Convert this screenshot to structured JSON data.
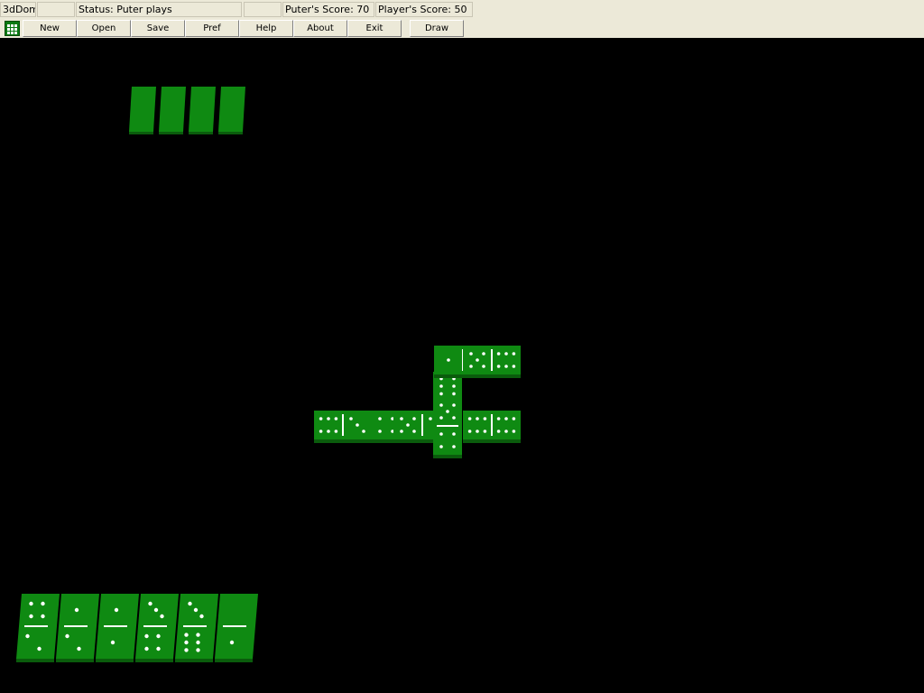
{
  "status": {
    "app_name": "3dDom",
    "blank1": "",
    "status_text": "Status: Puter plays",
    "blank2": "",
    "puter_score": "Puter's Score: 70",
    "player_score": "Player's Score: 50"
  },
  "toolbar": {
    "new_label": "New",
    "open_label": "Open",
    "save_label": "Save",
    "pref_label": "Pref",
    "help_label": "Help",
    "about_label": "About",
    "exit_label": "Exit",
    "draw_label": "Draw"
  },
  "game": {
    "tile_color": "#0f8a12",
    "tile_side_color": "#0a5c0c",
    "pip_color": "#ffffff",
    "opponent_tiles_count": 4,
    "player_hand": [
      [
        4,
        2
      ],
      [
        1,
        2
      ],
      [
        1,
        1
      ],
      [
        3,
        4
      ],
      [
        3,
        6
      ],
      [
        0,
        1
      ]
    ],
    "board_tiles": [
      {
        "a": 6,
        "b": 3,
        "orient": "h"
      },
      {
        "a": 4,
        "b": 4,
        "orient": "h"
      },
      {
        "a": 5,
        "b": 3,
        "orient": "h"
      },
      {
        "a": 5,
        "b": 4,
        "orient": "v"
      },
      {
        "a": 6,
        "b": 6,
        "orient": "h"
      },
      {
        "a": 1,
        "b": 5,
        "orient": "h"
      },
      {
        "a": 6,
        "b": 5,
        "orient": "v"
      }
    ]
  }
}
